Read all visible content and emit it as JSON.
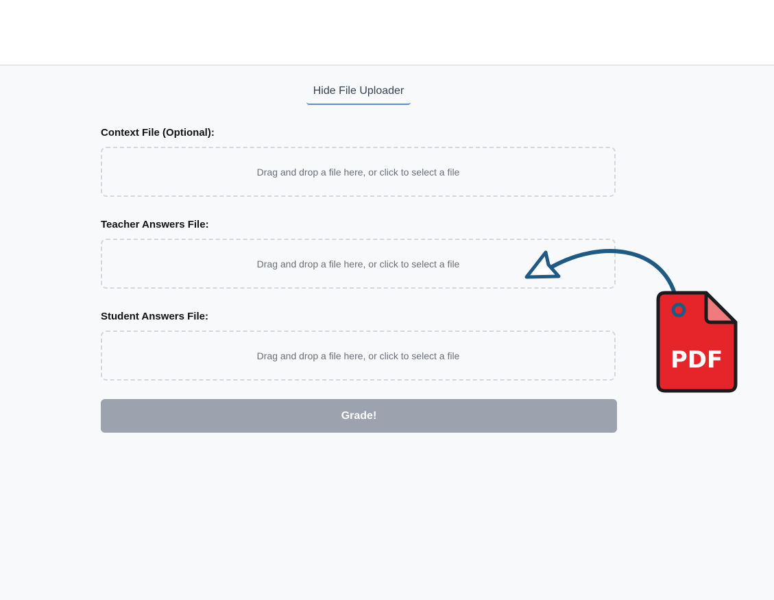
{
  "uploader": {
    "toggle_label": "Hide File Uploader",
    "fields": [
      {
        "label": "Context File (Optional):",
        "dropzone_text": "Drag and drop a file here, or click to select a file"
      },
      {
        "label": "Teacher Answers File:",
        "dropzone_text": "Drag and drop a file here, or click to select a file"
      },
      {
        "label": "Student Answers File:",
        "dropzone_text": "Drag and drop a file here, or click to select a file"
      }
    ],
    "submit_label": "Grade!"
  },
  "overlay": {
    "pdf_icon_text": "PDF",
    "icons": [
      "curved-arrow-icon",
      "pdf-file-icon"
    ]
  },
  "colors": {
    "page_bg": "#f8f9fb",
    "header_bg": "#ffffff",
    "accent": "#5b8ed6",
    "button_disabled": "#9ca3ae",
    "pdf_red": "#e5252a",
    "arrow_blue": "#1f5a85"
  }
}
